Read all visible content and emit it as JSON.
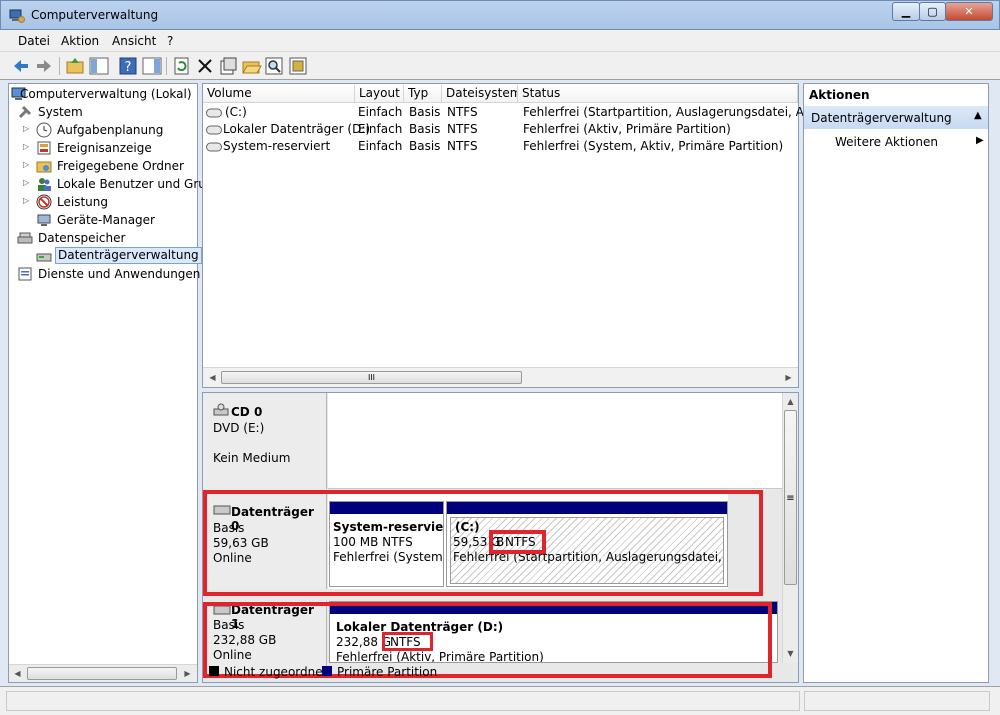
{
  "window": {
    "title": "Computerverwaltung",
    "min": "▁",
    "max": "▢",
    "close": "✕"
  },
  "menu": [
    "Datei",
    "Aktion",
    "Ansicht",
    "?"
  ],
  "toolbar": [
    "back-arrow-icon",
    "forward-arrow-icon",
    "up-folder-icon",
    "show-hide-tree-icon",
    "help-icon",
    "show-hide-action-icon",
    "refresh-icon",
    "delete-icon",
    "properties-icon",
    "open-icon",
    "search-icon",
    "settings-icon"
  ],
  "tree": [
    {
      "label": "Computerverwaltung (Lokal)",
      "icon": "computer-icon",
      "level": 0,
      "expander": ""
    },
    {
      "label": "System",
      "icon": "tools-icon",
      "level": 1,
      "expander": "◢"
    },
    {
      "label": "Aufgabenplanung",
      "icon": "clock-icon",
      "level": 2,
      "expander": "▷"
    },
    {
      "label": "Ereignisanzeige",
      "icon": "event-viewer-icon",
      "level": 2,
      "expander": "▷"
    },
    {
      "label": "Freigegebene Ordner",
      "icon": "shared-folder-icon",
      "level": 2,
      "expander": "▷"
    },
    {
      "label": "Lokale Benutzer und Grupp",
      "icon": "users-icon",
      "level": 2,
      "expander": "▷"
    },
    {
      "label": "Leistung",
      "icon": "performance-icon",
      "level": 2,
      "expander": "▷"
    },
    {
      "label": "Geräte-Manager",
      "icon": "device-manager-icon",
      "level": 2,
      "expander": ""
    },
    {
      "label": "Datenspeicher",
      "icon": "storage-icon",
      "level": 1,
      "expander": "◢"
    },
    {
      "label": "Datenträgerverwaltung",
      "icon": "disk-management-icon",
      "level": 2,
      "expander": ""
    },
    {
      "label": "Dienste und Anwendungen",
      "icon": "services-icon",
      "level": 1,
      "expander": "▷"
    }
  ],
  "list": {
    "columns": [
      "Volume",
      "Layout",
      "Typ",
      "Dateisystem",
      "Status"
    ],
    "rows": [
      [
        "(C:)",
        "Einfach",
        "Basis",
        "NTFS",
        "Fehlerfrei (Startpartition, Auslagerungsdatei, Absturz"
      ],
      [
        "Lokaler Datenträger (D:)",
        "Einfach",
        "Basis",
        "NTFS",
        "Fehlerfrei (Aktiv, Primäre Partition)"
      ],
      [
        "System-reserviert",
        "Einfach",
        "Basis",
        "NTFS",
        "Fehlerfrei (System, Aktiv, Primäre Partition)"
      ]
    ],
    "hscroll_grip": "III"
  },
  "disks": {
    "cd0": {
      "title": "CD 0",
      "line1": "DVD (E:)",
      "line2": "Kein Medium"
    },
    "disk0": {
      "title": "Datenträger 0",
      "type": "Basis",
      "size": "59,63 GB",
      "state": "Online",
      "p1": {
        "name": "System-reserviert",
        "size": "100 MB NTFS",
        "status": "Fehlerfrei (System, A"
      },
      "p2": {
        "name": "(C:)",
        "size_a": "59,53 G",
        "size_b": "B",
        "fs": "NTFS",
        "status": "Fehlerfrei (Startpartition, Auslagerungsdatei, Abstu"
      }
    },
    "disk1": {
      "title": "Datenträger 1",
      "type": "Basis",
      "size": "232,88 GB",
      "state": "Online",
      "p1": {
        "name": "Lokaler Datenträger  (D:)",
        "size_a": "232,88 G",
        "fs": "NTFS",
        "status": "Fehlerfrei (Aktiv, Primäre Partition)"
      }
    },
    "legend": {
      "unallocated": "Nicht zugeordnet",
      "primary": "Primäre Partition"
    },
    "vscroll_grip": "≡"
  },
  "actions": {
    "header": "Aktionen",
    "section": "Datenträgerverwaltung",
    "more": "Weitere Aktionen"
  },
  "colors": {
    "primary_partition": "#00007f",
    "highlight": "#e0242c"
  }
}
